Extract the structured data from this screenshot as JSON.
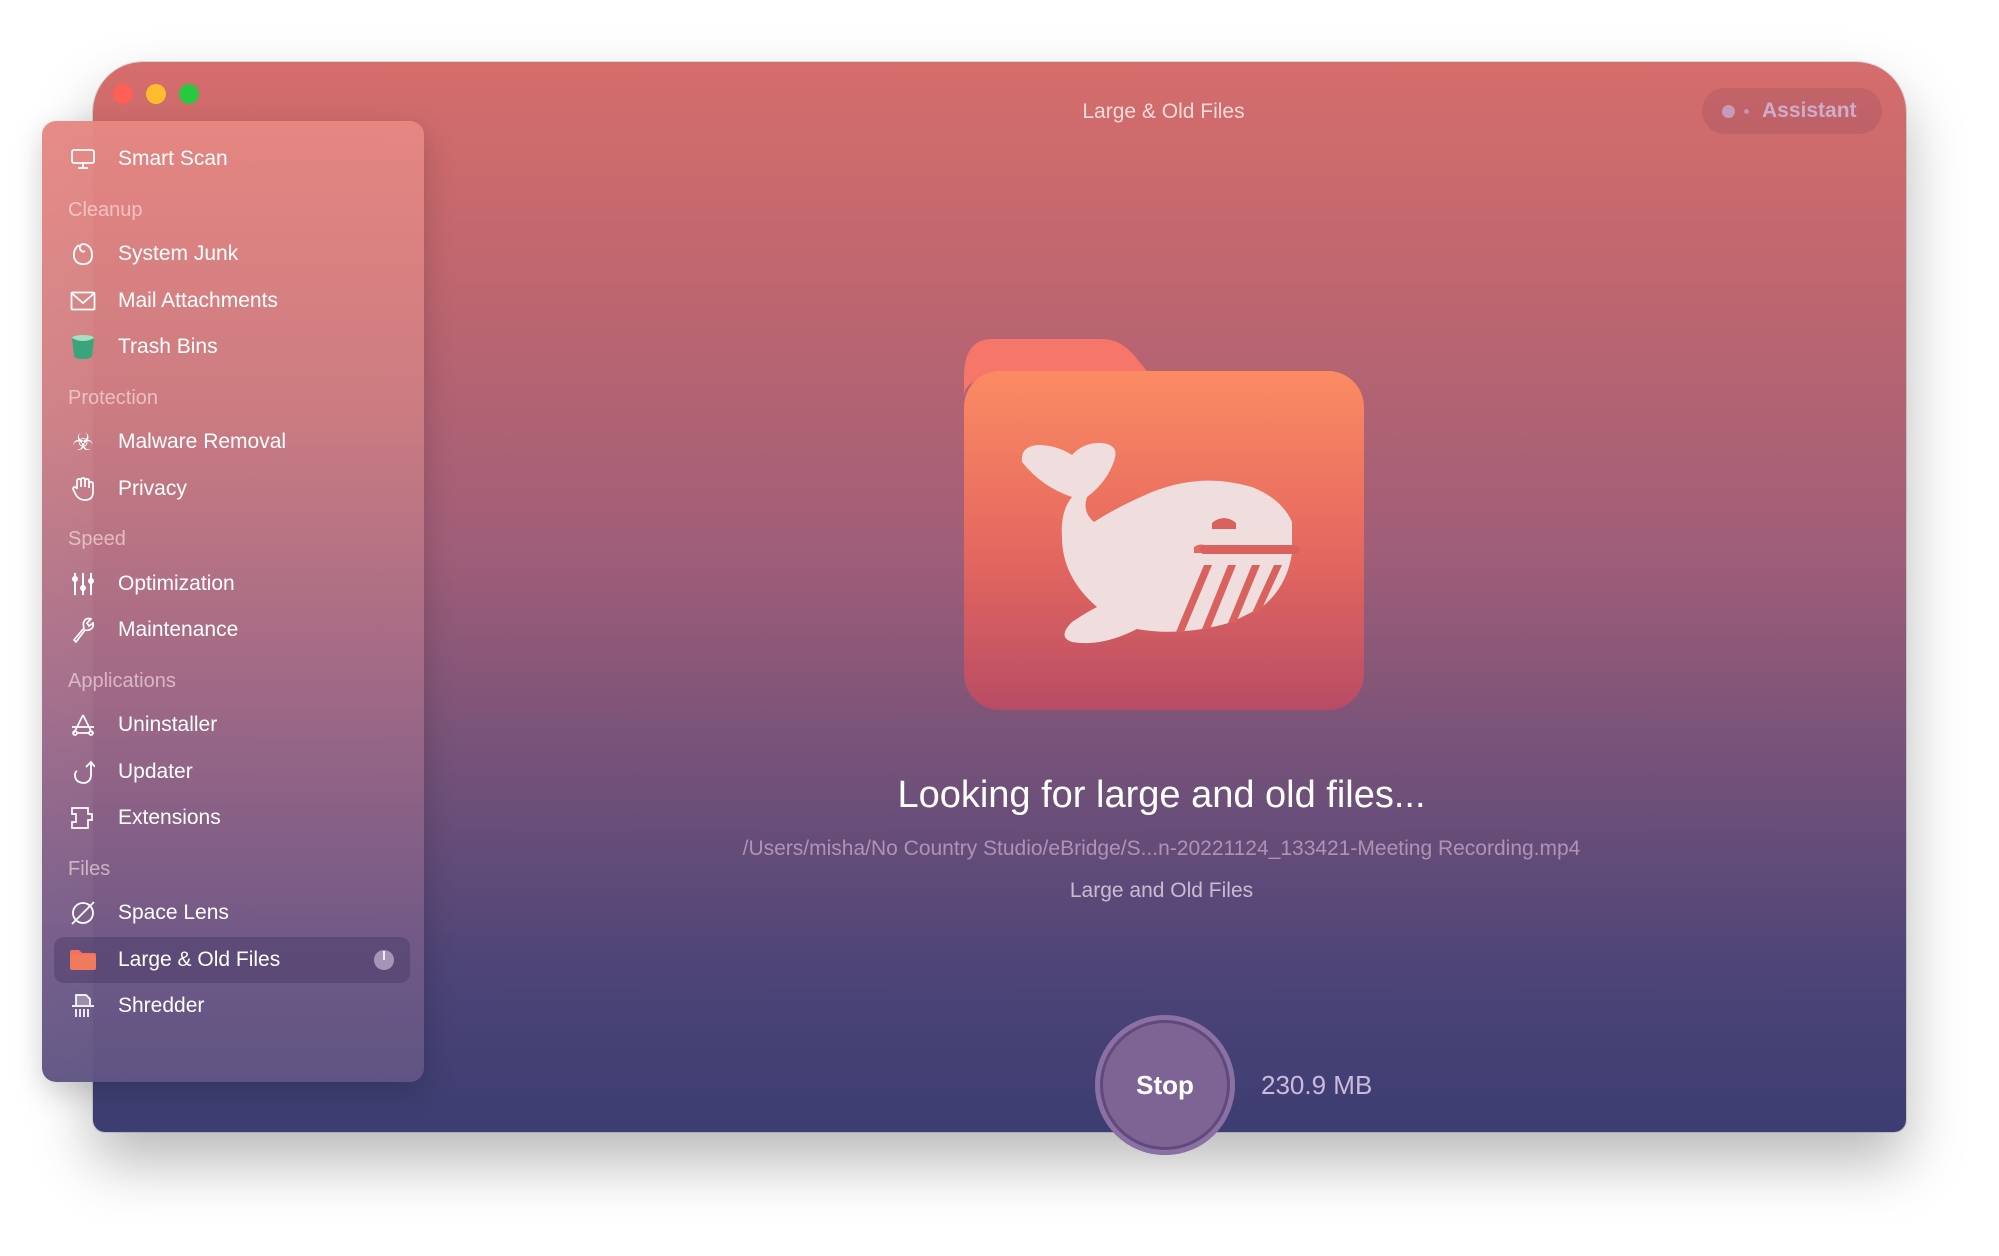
{
  "window": {
    "title": "Large & Old Files",
    "assistant_label": "Assistant",
    "traffic_lights": {
      "close": "#fe5f57",
      "minimize": "#febc2e",
      "maximize": "#28c840"
    }
  },
  "sidebar": {
    "items": [
      {
        "type": "item",
        "label": "Smart Scan",
        "icon": "monitor-icon"
      },
      {
        "type": "header",
        "label": "Cleanup"
      },
      {
        "type": "item",
        "label": "System Junk",
        "icon": "system-junk-icon"
      },
      {
        "type": "item",
        "label": "Mail Attachments",
        "icon": "envelope-icon"
      },
      {
        "type": "item",
        "label": "Trash Bins",
        "icon": "trash-icon"
      },
      {
        "type": "header",
        "label": "Protection"
      },
      {
        "type": "item",
        "label": "Malware Removal",
        "icon": "biohazard-icon"
      },
      {
        "type": "item",
        "label": "Privacy",
        "icon": "hand-icon"
      },
      {
        "type": "header",
        "label": "Speed"
      },
      {
        "type": "item",
        "label": "Optimization",
        "icon": "sliders-icon"
      },
      {
        "type": "item",
        "label": "Maintenance",
        "icon": "wrench-icon"
      },
      {
        "type": "header",
        "label": "Applications"
      },
      {
        "type": "item",
        "label": "Uninstaller",
        "icon": "uninstaller-icon"
      },
      {
        "type": "item",
        "label": "Updater",
        "icon": "update-arrow-icon"
      },
      {
        "type": "item",
        "label": "Extensions",
        "icon": "puzzle-icon"
      },
      {
        "type": "header",
        "label": "Files"
      },
      {
        "type": "item",
        "label": "Space Lens",
        "icon": "planet-icon"
      },
      {
        "type": "item",
        "label": "Large & Old Files",
        "icon": "folder-icon",
        "selected": true,
        "in_progress": true
      },
      {
        "type": "item",
        "label": "Shredder",
        "icon": "shredder-icon"
      }
    ]
  },
  "main": {
    "heading": "Looking for large and old files...",
    "current_path": "/Users/misha/No Country Studio/eBridge/S...n-20221124_133421-Meeting Recording.mp4",
    "subtitle": "Large and Old Files",
    "stop_label": "Stop",
    "found_size": "230.9 MB"
  }
}
